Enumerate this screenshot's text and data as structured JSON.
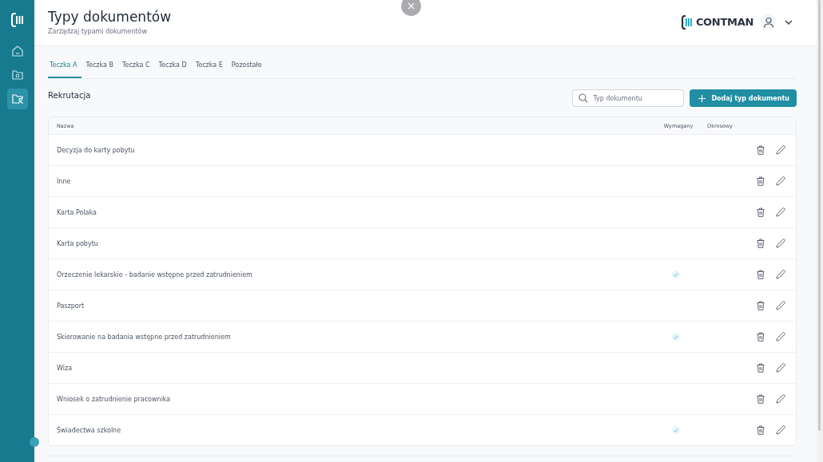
{
  "close_button": {
    "label": "×"
  },
  "sidebar": {
    "items": [
      {
        "kind": "home",
        "selected": false
      },
      {
        "kind": "folder",
        "selected": false
      },
      {
        "kind": "folder-user",
        "selected": true
      }
    ]
  },
  "header": {
    "title": "Typy dokumentów",
    "subtitle": "Zarządzaj typami dokumentów",
    "brand": "CONTMAN"
  },
  "tabs": [
    {
      "label": "Teczka A",
      "selected": true
    },
    {
      "label": "Teczka B",
      "selected": false
    },
    {
      "label": "Teczka C",
      "selected": false
    },
    {
      "label": "Teczka D",
      "selected": false
    },
    {
      "label": "Teczka E",
      "selected": false
    },
    {
      "label": "Pozostałe",
      "selected": false
    }
  ],
  "section": {
    "title": "Rekrutacja",
    "search": {
      "placeholder": "Typ dokumentu"
    },
    "add_button": "Dodaj typ dokumentu"
  },
  "table": {
    "columns": [
      "Nazwa",
      "Wymagany",
      "Okresowy"
    ],
    "rows": [
      {
        "name": "Decyzja do karty pobytu",
        "required": false,
        "periodic": false
      },
      {
        "name": "Inne",
        "required": false,
        "periodic": false
      },
      {
        "name": "Karta Polaka",
        "required": false,
        "periodic": false
      },
      {
        "name": "Karta pobytu",
        "required": false,
        "periodic": false
      },
      {
        "name": "Orzeczenie lekarskie - badanie wstępne przed zatrudnieniem",
        "required": true,
        "periodic": false
      },
      {
        "name": "Paszport",
        "required": false,
        "periodic": false
      },
      {
        "name": "Skierowanie na badania wstępne przed zatrudnieniem",
        "required": true,
        "periodic": false
      },
      {
        "name": "Wiza",
        "required": false,
        "periodic": false
      },
      {
        "name": "Wniosek o zatrudnienie pracownika",
        "required": false,
        "periodic": false
      },
      {
        "name": "Świadectwa szkolne",
        "required": true,
        "periodic": false
      }
    ]
  }
}
